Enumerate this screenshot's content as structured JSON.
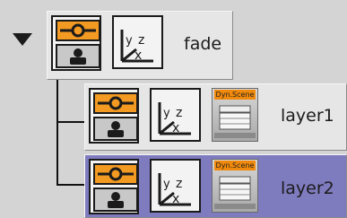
{
  "nodes": [
    {
      "name": "fade",
      "expander": "expand-triangle",
      "icons": [
        "visibility-eye-icon",
        "solo-person-icon",
        "transform-axis-icon"
      ]
    },
    {
      "name": "layer1",
      "thumb_label": "Dyn.Scene",
      "icons": [
        "visibility-eye-icon",
        "solo-person-icon",
        "transform-axis-icon",
        "clapperboard-icon"
      ]
    },
    {
      "name": "layer2",
      "thumb_label": "Dyn.Scene",
      "icons": [
        "visibility-eye-icon",
        "solo-person-icon",
        "transform-axis-icon",
        "clapperboard-icon"
      ],
      "selected": true
    }
  ],
  "axis_labels": {
    "y": "y",
    "z": "z",
    "x": "x"
  },
  "colors": {
    "background": "#d4d4d4",
    "node_bg": "#e6e6e6",
    "selected_bg": "#7f7bbf",
    "eye_orange": "#f39a22",
    "thumb_tag": "#f18a0c"
  }
}
